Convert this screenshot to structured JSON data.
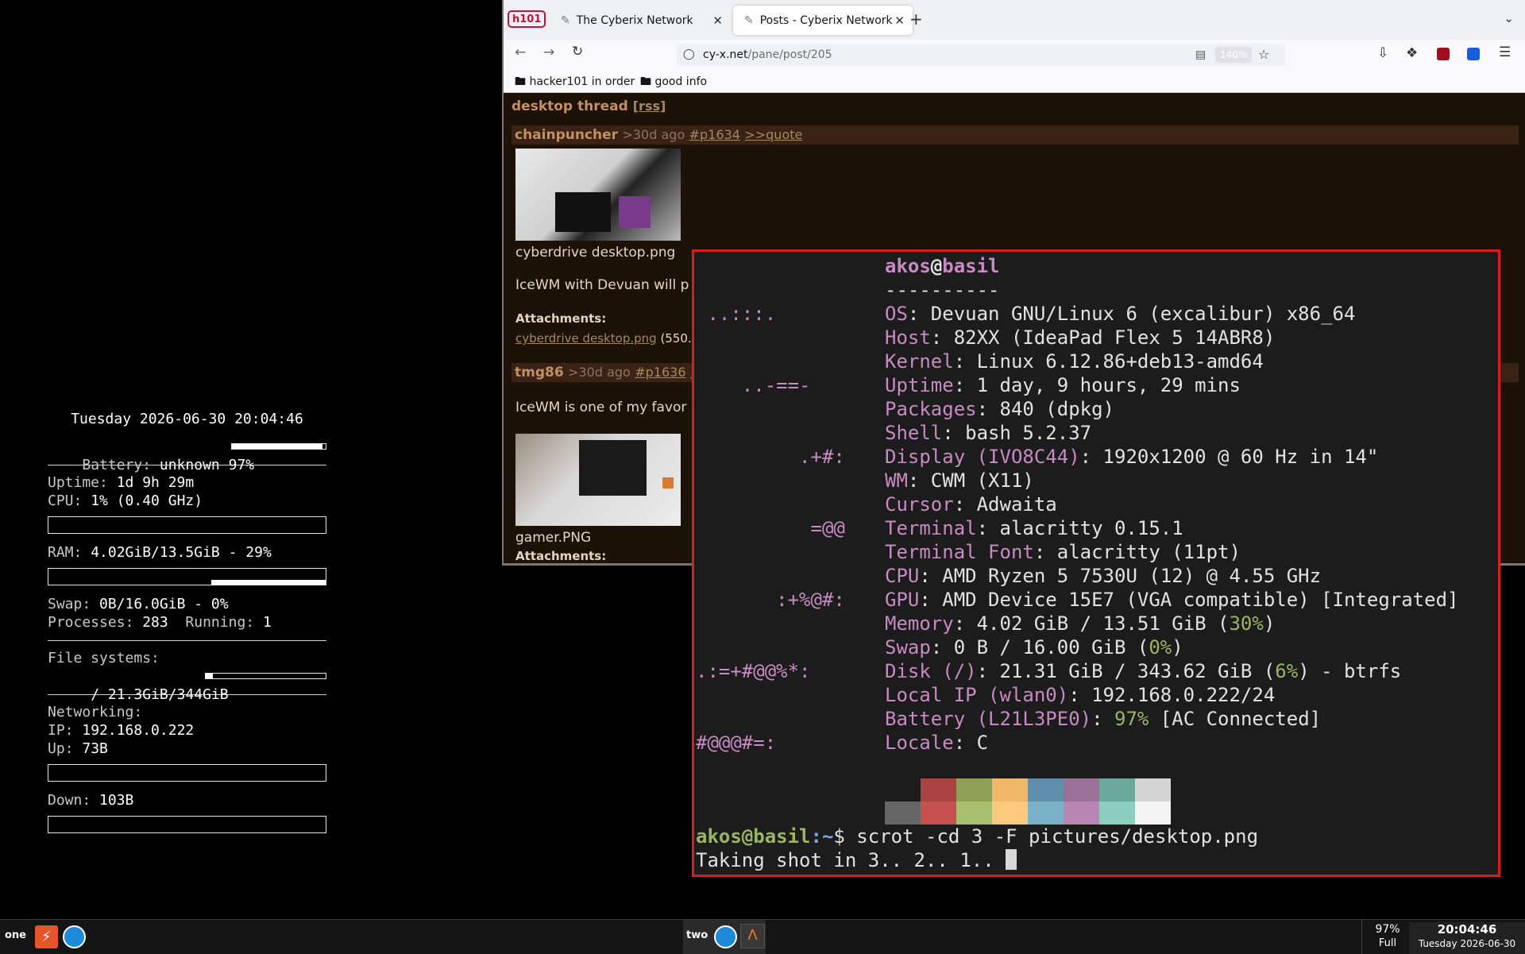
{
  "conky": {
    "datetime": "Tuesday 2026-06-30 20:04:46",
    "battery_label": "Battery:",
    "battery_value": "unknown 97%",
    "battery_level": 0.97,
    "uptime_label": "Uptime:",
    "uptime_value": "1d 9h 29m",
    "cpu_label": "CPU:",
    "cpu_value": "1% (0.40 GHz)",
    "cpu_level": 0.01,
    "ram_label": "RAM:",
    "ram_value": "4.02GiB/13.5GiB - 29%",
    "swap_label": "Swap:",
    "swap_value": "0B/16.0GiB - 0%",
    "processes_label": "Processes:",
    "processes_value": "283",
    "running_label": "Running:",
    "running_value": "1",
    "fs_label": "File systems:",
    "fs_root": " / 21.3GiB/344GiB",
    "fs_level": 0.06,
    "net_label": "Networking:",
    "ip_label": "IP:",
    "ip_value": "192.168.0.222",
    "up_label": "Up:",
    "up_value": "73B",
    "down_label": "Down:",
    "down_value": "103B"
  },
  "browser": {
    "tabs": [
      {
        "label": "The Cyberix Network"
      },
      {
        "label": "Posts - Cyberix Network"
      }
    ],
    "pinned_badge": "h101",
    "url_host": "cy-x.net",
    "url_path": "/pane/post/205",
    "zoom": "140%",
    "bookmarks": [
      "hacker101 in order",
      "good info"
    ],
    "page": {
      "thread_title": "desktop thread",
      "rss": "[rss]",
      "posts": [
        {
          "user": "chainpuncher",
          "age": ">30d ago",
          "id": "#p1634",
          "quote": ">>quote",
          "image_caption": "cyberdrive desktop.png",
          "body": "IceWM with Devuan will p",
          "attachments_label": "Attachments:",
          "attachment_link": "cyberdrive desktop.png",
          "attachment_size": "(550."
        },
        {
          "user": "tmg86",
          "age": ">30d ago",
          "id": "#p1636",
          "quote": ">",
          "body": "IceWM is one of my favor",
          "image_caption": "gamer.PNG",
          "attachments_label": "Attachments:"
        }
      ]
    }
  },
  "terminal": {
    "user": "akos",
    "at": "@",
    "host": "basil",
    "separator": "----------",
    "logo": [
      " ..:::.",
      "    ..-==-",
      "         .+#:",
      "          =@@",
      "       :+%@#:",
      ".:=+#@@%*:",
      "#@@@#=:"
    ],
    "info": [
      {
        "key": "OS",
        "value": ": Devuan GNU/Linux 6 (excalibur) x86_64"
      },
      {
        "key": "Host",
        "value": ": 82XX (IdeaPad Flex 5 14ABR8)"
      },
      {
        "key": "Kernel",
        "value": ": Linux 6.12.86+deb13-amd64"
      },
      {
        "key": "Uptime",
        "value": ": 1 day, 9 hours, 29 mins"
      },
      {
        "key": "Packages",
        "value": ": 840 (dpkg)"
      },
      {
        "key": "Shell",
        "value": ": bash 5.2.37"
      },
      {
        "key": "Display (IVO8C44)",
        "value": ": 1920x1200 @ 60 Hz in 14\""
      },
      {
        "key": "WM",
        "value": ": CWM (X11)"
      },
      {
        "key": "Cursor",
        "value": ": Adwaita"
      },
      {
        "key": "Terminal",
        "value": ": alacritty 0.15.1"
      },
      {
        "key": "Terminal Font",
        "value": ": alacritty (11pt)"
      },
      {
        "key": "CPU",
        "value": ": AMD Ryzen 5 7530U (12) @ 4.55 GHz"
      },
      {
        "key": "GPU",
        "value": ": AMD Device 15E7 (VGA compatible) [Integrated]"
      }
    ],
    "memory": {
      "key": "Memory",
      "pre": ": 4.02 GiB / 13.51 GiB (",
      "pct": "30%",
      "post": ")"
    },
    "swap": {
      "key": "Swap",
      "pre": ": 0 B / 16.00 GiB (",
      "pct": "0%",
      "post": ")"
    },
    "disk": {
      "key": "Disk (/)",
      "pre": ": 21.31 GiB / 343.62 GiB (",
      "pct": "6%",
      "post": ") - btrfs"
    },
    "localip": {
      "key": "Local IP (wlan0)",
      "value": ": 192.168.0.222/24"
    },
    "battery": {
      "key": "Battery (L21L3PE0)",
      "pre": ": ",
      "pct": "97%",
      "post": " [AC Connected]"
    },
    "locale": {
      "key": "Locale",
      "value": ": C"
    },
    "palette_top": [
      "#1c1c1c",
      "#a94442",
      "#8fa056",
      "#f0b767",
      "#5f8fab",
      "#9b7097",
      "#6aa99a",
      "#d4d4d4"
    ],
    "palette_bottom": [
      "#666666",
      "#c5504e",
      "#a7bf6e",
      "#fdc97d",
      "#7bb0c9",
      "#b985b3",
      "#8dcfbf",
      "#f4f4f4"
    ],
    "prompt_user": "akos@basil",
    "prompt_path": ":~",
    "prompt_symbol": "$",
    "command": " scrot -cd 3 -F pictures/desktop.png",
    "output": "Taking shot in 3.. 2.. 1.."
  },
  "taskbar": {
    "workspace1": "one",
    "workspace2": "two",
    "battery_pct": "97%",
    "battery_status": "Full",
    "clock_time": "20:04:46",
    "clock_date": "Tuesday 2026-06-30"
  }
}
